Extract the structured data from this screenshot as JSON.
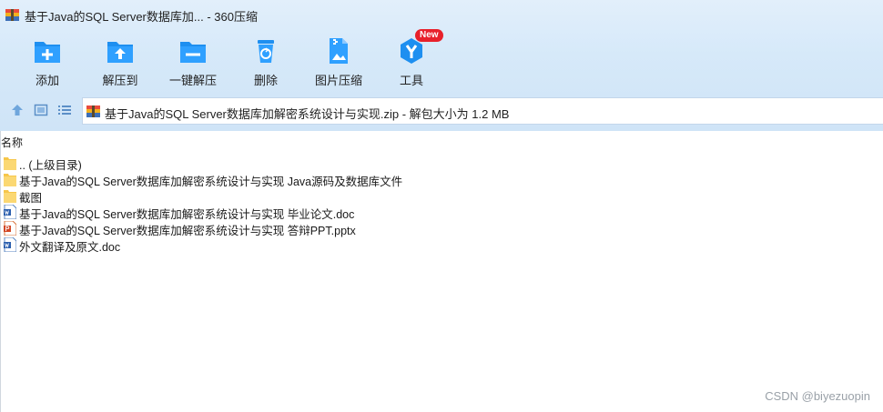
{
  "window": {
    "title": "基于Java的SQL Server数据库加... - 360压缩"
  },
  "toolbar": {
    "items": [
      {
        "label": "添加",
        "icon": "add-icon"
      },
      {
        "label": "解压到",
        "icon": "extract-to-icon"
      },
      {
        "label": "一键解压",
        "icon": "one-click-extract-icon"
      },
      {
        "label": "删除",
        "icon": "delete-icon"
      },
      {
        "label": "图片压缩",
        "icon": "image-compress-icon"
      },
      {
        "label": "工具",
        "icon": "tools-icon",
        "badge": "New"
      }
    ]
  },
  "nav": {
    "path_text": "基于Java的SQL Server数据库加解密系统设计与实现.zip - 解包大小为 1.2 MB"
  },
  "file_list": {
    "column_header": "名称",
    "rows": [
      {
        "name": ".. (上级目录)",
        "type": "folder"
      },
      {
        "name": "基于Java的SQL Server数据库加解密系统设计与实现 Java源码及数据库文件",
        "type": "folder"
      },
      {
        "name": "截图",
        "type": "folder"
      },
      {
        "name": "基于Java的SQL Server数据库加解密系统设计与实现 毕业论文.doc",
        "type": "doc"
      },
      {
        "name": "基于Java的SQL Server数据库加解密系统设计与实现 答辩PPT.pptx",
        "type": "ppt"
      },
      {
        "name": "外文翻译及原文.doc",
        "type": "doc"
      }
    ]
  },
  "watermark": "CSDN @biyezuopin",
  "colors": {
    "accent": "#1e8ff0",
    "badge": "#e8212b",
    "folder": "#f6c64a"
  }
}
